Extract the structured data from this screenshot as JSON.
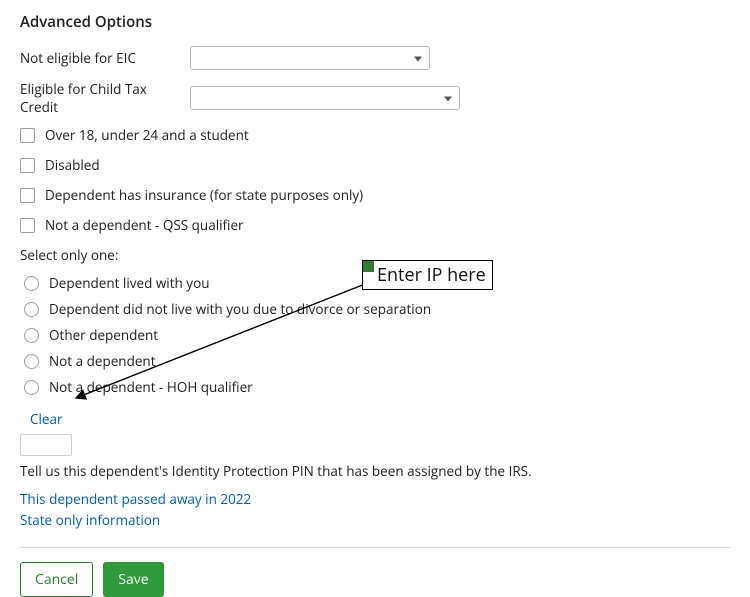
{
  "section_title": "Advanced Options",
  "dropdowns": {
    "eic_label": "Not eligible for EIC",
    "ctc_label": "Eligible for Child Tax Credit"
  },
  "checkboxes": {
    "student": "Over 18, under 24 and a student",
    "disabled": "Disabled",
    "insurance": "Dependent has insurance (for state purposes only)",
    "qss": "Not a dependent - QSS qualifier"
  },
  "radio_heading": "Select only one:",
  "radios": {
    "lived": "Dependent lived with you",
    "divorce": "Dependent did not live with you due to divorce or separation",
    "other": "Other dependent",
    "not_dep": "Not a dependent",
    "hoh": "Not a dependent - HOH qualifier"
  },
  "clear_link": "Clear",
  "ip_help": "Tell us this dependent's Identity Protection PIN that has been assigned by the IRS.",
  "links": {
    "passed_away": "This dependent passed away in 2022",
    "state_only": "State only information"
  },
  "buttons": {
    "cancel": "Cancel",
    "save": "Save"
  },
  "annotation": {
    "text": "Enter IP here"
  }
}
